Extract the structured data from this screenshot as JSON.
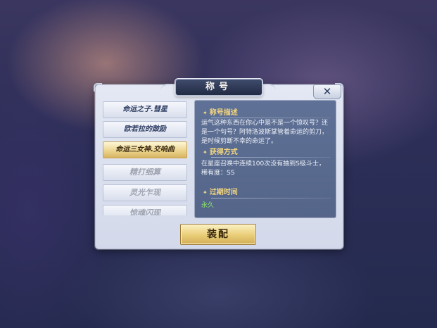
{
  "dialog": {
    "title": "称号",
    "close_label": "✕"
  },
  "titles_list": {
    "items": [
      {
        "label": "命运之子.彗星",
        "state": "normal"
      },
      {
        "label": "欧若拉的鼓励",
        "state": "normal"
      },
      {
        "label": "命运三女神.交响曲",
        "state": "selected"
      },
      {
        "label": "精打细算",
        "state": "locked"
      },
      {
        "label": "灵光乍现",
        "state": "locked"
      },
      {
        "label": "惊魂闪现",
        "state": "locked"
      }
    ]
  },
  "detail": {
    "description_heading": "称号描述",
    "description_text": "运气这种东西在你心中是不是一个惊叹号？还是一个句号？阿特洛波斯掌管着命运的剪刀，是时候剪断不幸的命运了。",
    "obtain_heading": "获得方式",
    "obtain_text": "在星座召唤中连续100次没有抽到S级斗士，稀有度：SS",
    "expiry_heading": "过期时间",
    "expiry_text": "永久"
  },
  "actions": {
    "equip_label": "装配"
  },
  "colors": {
    "accent_gold": "#ebd07c",
    "heading_gold": "#f4d67e",
    "expiry_green": "#8ee86a",
    "panel_blue": "#5f7196"
  }
}
